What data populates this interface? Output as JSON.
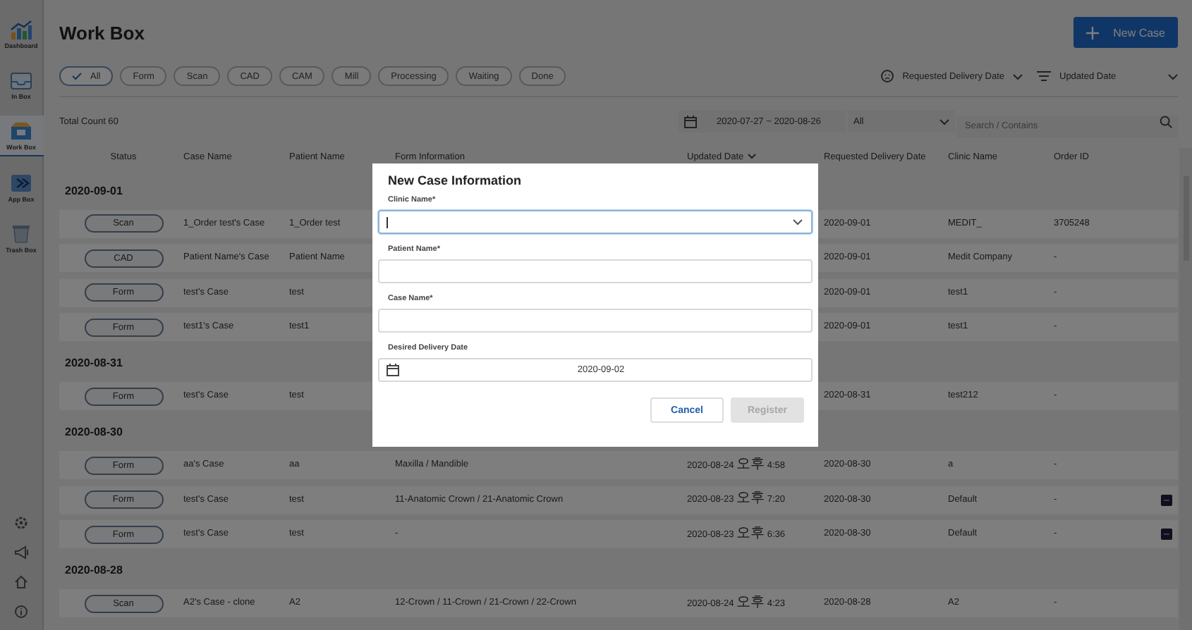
{
  "sidebar": {
    "items": [
      {
        "label": "Dashboard",
        "selected": false
      },
      {
        "label": "In Box",
        "selected": false
      },
      {
        "label": "Work Box",
        "selected": true
      },
      {
        "label": "App Box",
        "selected": false
      },
      {
        "label": "Trash Box",
        "selected": false
      }
    ]
  },
  "page": {
    "title": "Work Box",
    "new_case_button": "New Case",
    "filters": [
      {
        "label": "All",
        "selected": true
      },
      {
        "label": "Form",
        "selected": false
      },
      {
        "label": "Scan",
        "selected": false
      },
      {
        "label": "CAD",
        "selected": false
      },
      {
        "label": "CAM",
        "selected": false
      },
      {
        "label": "Mill",
        "selected": false
      },
      {
        "label": "Processing",
        "selected": false
      },
      {
        "label": "Waiting",
        "selected": false
      },
      {
        "label": "Done",
        "selected": false
      }
    ],
    "sort_requested": "Requested Delivery Date",
    "sort_updated": "Updated Date",
    "total_count": "Total Count 60",
    "date_range": "2020-07-27 ~ 2020-08-26",
    "scope": "All",
    "search": {
      "placeholder": "Search / Contains"
    }
  },
  "table": {
    "columns": [
      "Status",
      "Case Name",
      "Patient Name",
      "Form Information",
      "Updated Date",
      "Requested Delivery Date",
      "Clinic Name",
      "Order ID"
    ],
    "groups": [
      {
        "date": "2020-09-01",
        "rows": [
          {
            "status": "Scan",
            "case_name": "1_Order test's Case",
            "patient_name": "1_Order test",
            "requested_delivery_date": "2020-09-01",
            "clinic_name": "MEDIT_",
            "order_id": "3705248",
            "tagged": false
          },
          {
            "status": "CAD",
            "case_name": "Patient Name's Case",
            "patient_name": "Patient Name",
            "requested_delivery_date": "2020-09-01",
            "clinic_name": "Medit Company",
            "order_id": "-",
            "tagged": false
          },
          {
            "status": "Form",
            "case_name": "test's Case",
            "patient_name": "test",
            "requested_delivery_date": "2020-09-01",
            "clinic_name": "test1",
            "order_id": "-",
            "tagged": false
          },
          {
            "status": "Form",
            "case_name": "test1's Case",
            "patient_name": "test1",
            "requested_delivery_date": "2020-09-01",
            "clinic_name": "test1",
            "order_id": "-",
            "tagged": false
          }
        ]
      },
      {
        "date": "2020-08-31",
        "rows": [
          {
            "status": "Form",
            "case_name": "test's Case",
            "patient_name": "test",
            "requested_delivery_date": "2020-08-31",
            "clinic_name": "test212",
            "order_id": "-",
            "tagged": false
          }
        ]
      },
      {
        "date": "2020-08-30",
        "rows": [
          {
            "status": "Form",
            "case_name": "aa's Case",
            "patient_name": "aa",
            "form_information": "Maxilla / Mandible",
            "updated_date": "2020-08-24 오후 4:58",
            "requested_delivery_date": "2020-08-30",
            "clinic_name": "a",
            "order_id": "-",
            "tagged": false
          },
          {
            "status": "Form",
            "case_name": "test's Case",
            "patient_name": "test",
            "form_information": "11-Anatomic Crown / 21-Anatomic Crown",
            "updated_date": "2020-08-23 오후 7:20",
            "requested_delivery_date": "2020-08-30",
            "clinic_name": "Default",
            "order_id": "-",
            "tagged": true
          },
          {
            "status": "Form",
            "case_name": "test's Case",
            "patient_name": "test",
            "form_information": "-",
            "updated_date": "2020-08-23 오후 6:36",
            "requested_delivery_date": "2020-08-30",
            "clinic_name": "Default",
            "order_id": "-",
            "tagged": true
          }
        ]
      },
      {
        "date": "2020-08-28",
        "rows": [
          {
            "status": "Scan",
            "case_name": "A2's Case - clone",
            "patient_name": "A2",
            "form_information": "12-Crown / 11-Crown / 21-Crown / 22-Crown",
            "updated_date": "2020-08-24 오후 4:23",
            "requested_delivery_date": "2020-08-28",
            "clinic_name": "A2",
            "order_id": "-",
            "tagged": false
          }
        ]
      }
    ]
  },
  "modal": {
    "title": "New Case Information",
    "fields": [
      {
        "kind": "select",
        "label": "Clinic Name*",
        "focused": true
      },
      {
        "kind": "text",
        "label": "Patient Name*",
        "focused": false
      },
      {
        "kind": "text",
        "label": "Case Name*",
        "focused": false
      },
      {
        "kind": "date",
        "label": "Desired Delivery Date",
        "value": "2020-09-02",
        "focused": false
      }
    ],
    "buttons": [
      {
        "label": "Cancel",
        "disabled": false
      },
      {
        "label": "Register",
        "disabled": true
      }
    ]
  }
}
